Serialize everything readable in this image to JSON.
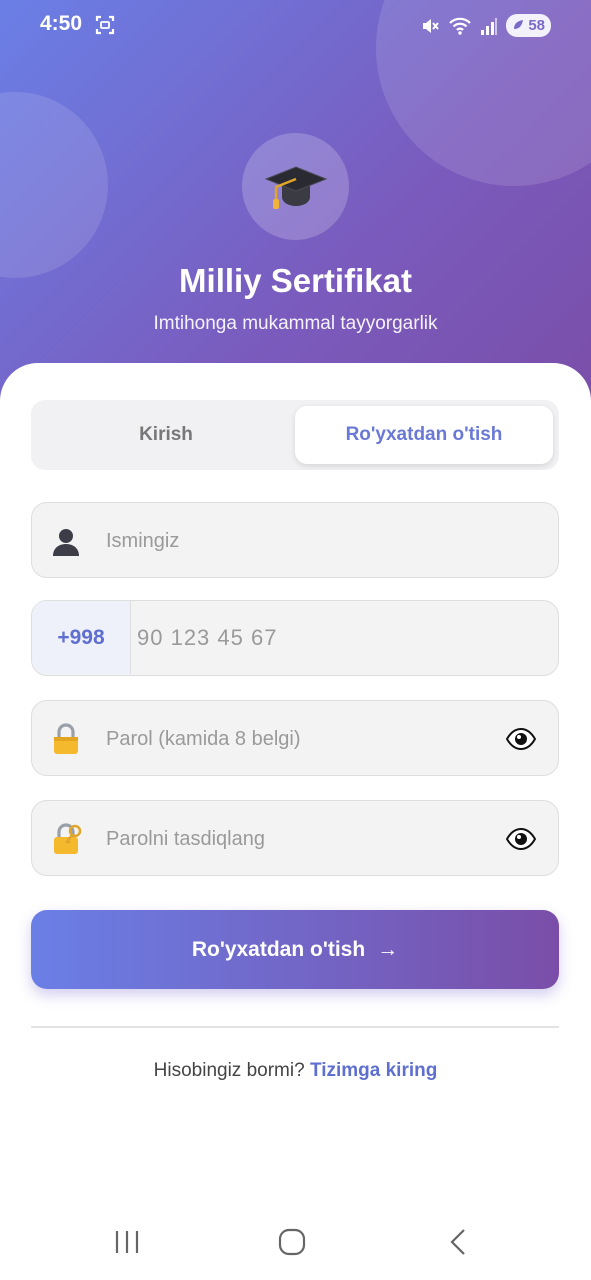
{
  "status_bar": {
    "time": "4:50",
    "battery": "58",
    "icons": [
      "screenshot-icon",
      "mute-icon",
      "wifi-icon",
      "signal-icon",
      "battery-icon"
    ]
  },
  "header": {
    "logo": "graduation-cap-icon",
    "title": "Milliy Sertifikat",
    "subtitle": "Imtihonga mukammal tayyorgarlik"
  },
  "tabs": [
    {
      "label": "Kirish",
      "active": false
    },
    {
      "label": "Ro'yxatdan o'tish",
      "active": true
    }
  ],
  "form": {
    "name_placeholder": "Ismingiz",
    "phone_prefix": "+998",
    "phone_placeholder": "90 123 45 67",
    "password_placeholder": "Parol (kamida 8 belgi)",
    "confirm_placeholder": "Parolni tasdiqlang",
    "submit_label": "Ro'yxatdan o'tish",
    "submit_arrow": "→"
  },
  "footer": {
    "question": "Hisobingiz bormi?",
    "link": "Tizimga kiring"
  },
  "colors": {
    "gradient_start": "#6a7fe6",
    "gradient_end": "#7a4ea8",
    "accent": "#5f6fcf"
  }
}
